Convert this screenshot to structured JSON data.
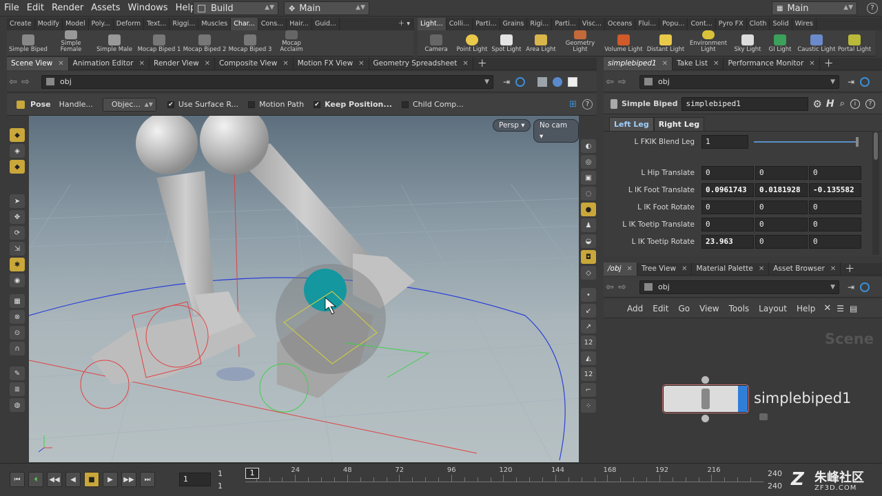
{
  "menu": [
    "File",
    "Edit",
    "Render",
    "Assets",
    "Windows",
    "Help"
  ],
  "desktop": {
    "build": "Build",
    "main": "Main",
    "main_right": "Main"
  },
  "shelf_tabs_left": [
    "Create",
    "Modify",
    "Model",
    "Poly...",
    "Deform",
    "Text...",
    "Riggi...",
    "Muscles",
    "Char...",
    "Cons...",
    "Hair...",
    "Guid..."
  ],
  "shelf_tabs_right": [
    "Light...",
    "Colli...",
    "Parti...",
    "Grains",
    "Rigi...",
    "Parti...",
    "Visc...",
    "Oceans",
    "Flui...",
    "Popu...",
    "Cont...",
    "Pyro FX",
    "Cloth",
    "Solid",
    "Wires"
  ],
  "shelf_tools_left": [
    "Simple Biped",
    "Simple Female",
    "Simple Male",
    "Mocap Biped 1",
    "Mocap Biped 2",
    "Mocap Biped 3",
    "Mocap Acclaim"
  ],
  "shelf_tools_right": [
    "Camera",
    "Point Light",
    "Spot Light",
    "Area Light",
    "Geometry Light",
    "Volume Light",
    "Distant Light",
    "Environment Light",
    "Sky Light",
    "GI Light",
    "Caustic Light",
    "Portal Light"
  ],
  "left_tabs": [
    "Scene View",
    "Animation Editor",
    "Render View",
    "Composite View",
    "Motion FX View",
    "Geometry Spreadsheet"
  ],
  "left_path": "obj",
  "pose_bar": {
    "pose": "Pose",
    "handle": "Handle...",
    "objec": "Objec...",
    "use_surface": "Use Surface R...",
    "motion_path": "Motion Path",
    "keep_position": "Keep Position...",
    "child_comp": "Child Comp..."
  },
  "viewport": {
    "persp": "Persp",
    "nocam": "No cam"
  },
  "right_tabs": [
    "simplebiped1",
    "Take List",
    "Performance Monitor"
  ],
  "right_path": "obj",
  "param": {
    "node_type": "Simple Biped",
    "node_name": "simplebiped1",
    "tabs": [
      "Left Leg",
      "Right Leg"
    ],
    "rows": [
      {
        "label": "L FKIK Blend Leg",
        "values": [
          "1"
        ]
      },
      {
        "label": "L Hip Translate",
        "values": [
          "0",
          "0",
          "0"
        ]
      },
      {
        "label": "L IK Foot Translate",
        "values": [
          "0.0961743",
          "0.0181928",
          "-0.135582"
        ]
      },
      {
        "label": "L IK Foot Rotate",
        "values": [
          "0",
          "0",
          "0"
        ]
      },
      {
        "label": "L IK Toetip Translate",
        "values": [
          "0",
          "0",
          "0"
        ]
      },
      {
        "label": "L IK Toetip Rotate",
        "values": [
          "23.963",
          "0",
          "0"
        ]
      }
    ]
  },
  "net_tabs": [
    "/obj",
    "Tree View",
    "Material Palette",
    "Asset Browser"
  ],
  "net_path": "obj",
  "net_menu": [
    "Add",
    "Edit",
    "Go",
    "View",
    "Tools",
    "Layout",
    "Help"
  ],
  "net": {
    "watermark": "Scene",
    "node_name": "simplebiped1"
  },
  "timeline": {
    "current": "1",
    "frame_field": "1",
    "start1": "1",
    "start2": "1",
    "ticks": [
      "24",
      "48",
      "72",
      "96",
      "120",
      "144",
      "168",
      "192",
      "216"
    ],
    "end1": "240",
    "end2": "240"
  },
  "logo": {
    "text": "朱峰社区",
    "url": "ZF3D.COM"
  },
  "colors": {
    "accent": "#2f7fd8",
    "handle_yellow": "#c9a73a",
    "red": "#e24040",
    "blue": "#2b3fd8",
    "green": "#3fd04a"
  }
}
